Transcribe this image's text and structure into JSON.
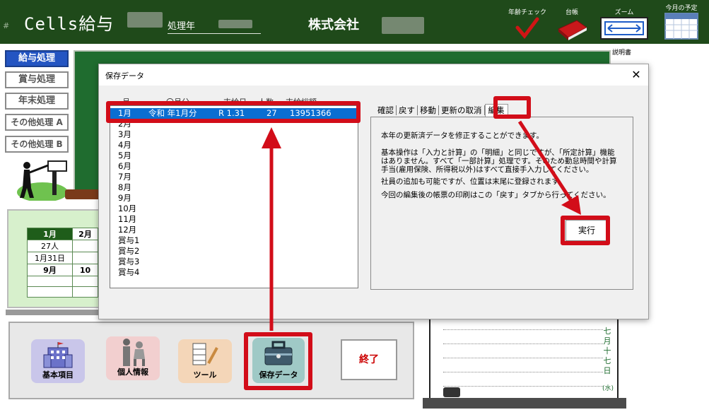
{
  "header": {
    "hash": "#",
    "app_title": "Cells給与",
    "year_label": "処理年",
    "company": "株式会社",
    "tools": [
      {
        "label": "年齢チェック",
        "icon": "check-mark-icon"
      },
      {
        "label": "台帳",
        "icon": "ledger-book-icon"
      },
      {
        "label": "ズーム",
        "icon": "zoom-icon"
      },
      {
        "label": "今月の予定",
        "icon": "calendar-icon"
      }
    ]
  },
  "side_menu": [
    {
      "label": "給与処理",
      "active": true
    },
    {
      "label": "賞与処理",
      "active": false
    },
    {
      "label": "年末処理",
      "active": false
    },
    {
      "label": "その他処理 A",
      "active": false
    },
    {
      "label": "その他処理 B",
      "active": false
    }
  ],
  "help_label": "説明書",
  "calendar": {
    "rows": [
      [
        "1月",
        "2月"
      ],
      [
        "27人",
        ""
      ],
      [
        "1月31日",
        ""
      ],
      [
        "9月",
        "10"
      ],
      [
        "",
        ""
      ],
      [
        "",
        ""
      ]
    ]
  },
  "toolbar": {
    "buttons": [
      {
        "label": "基本項目",
        "icon": "building-icon"
      },
      {
        "label": "個人情報",
        "icon": "people-icon"
      },
      {
        "label": "ツール",
        "icon": "tools-icon"
      },
      {
        "label": "保存データ",
        "icon": "toolbox-icon"
      }
    ],
    "exit_label": "終了"
  },
  "right_calendar": {
    "vertical_date": "七月十七日",
    "weekday": "(水)"
  },
  "dialog": {
    "title": "保存データ",
    "close": "✕",
    "columns": [
      "月",
      "〇月分",
      "支給日",
      "人数",
      "支給総額"
    ],
    "selected": {
      "month": "1月",
      "period": "令和 年1月分",
      "pay_date": "R  1.31",
      "count": "27",
      "total": "13951366"
    },
    "items": [
      "2月",
      "3月",
      "4月",
      "5月",
      "6月",
      "7月",
      "8月",
      "9月",
      "10月",
      "11月",
      "12月",
      "賞与1",
      "賞与2",
      "賞与3",
      "賞与4"
    ],
    "tabs": [
      "確認",
      "戻す",
      "移動",
      "更新の取消",
      "編集"
    ],
    "active_tab": "編集",
    "panel_text": [
      "本年の更新済データを修正することができます。",
      "基本操作は「入力と計算」の「明細」と同じですが、「所定計算」機能はありません。すべて「一部計算」処理です。そのため勤怠時間や計算手当(雇用保険、所得税以外)はすべて直接手入力してください。",
      "社員の追加も可能ですが、位置は末尾に登録されます。",
      "今回の編集後の帳票の印刷はこの「戻す」タブから行ってください。"
    ],
    "run_label": "実行"
  },
  "colors": {
    "header_bg": "#1f4a1a",
    "highlight_red": "#d20d19",
    "selection_blue": "#0a6ed1",
    "active_menu_blue": "#2455c2"
  }
}
